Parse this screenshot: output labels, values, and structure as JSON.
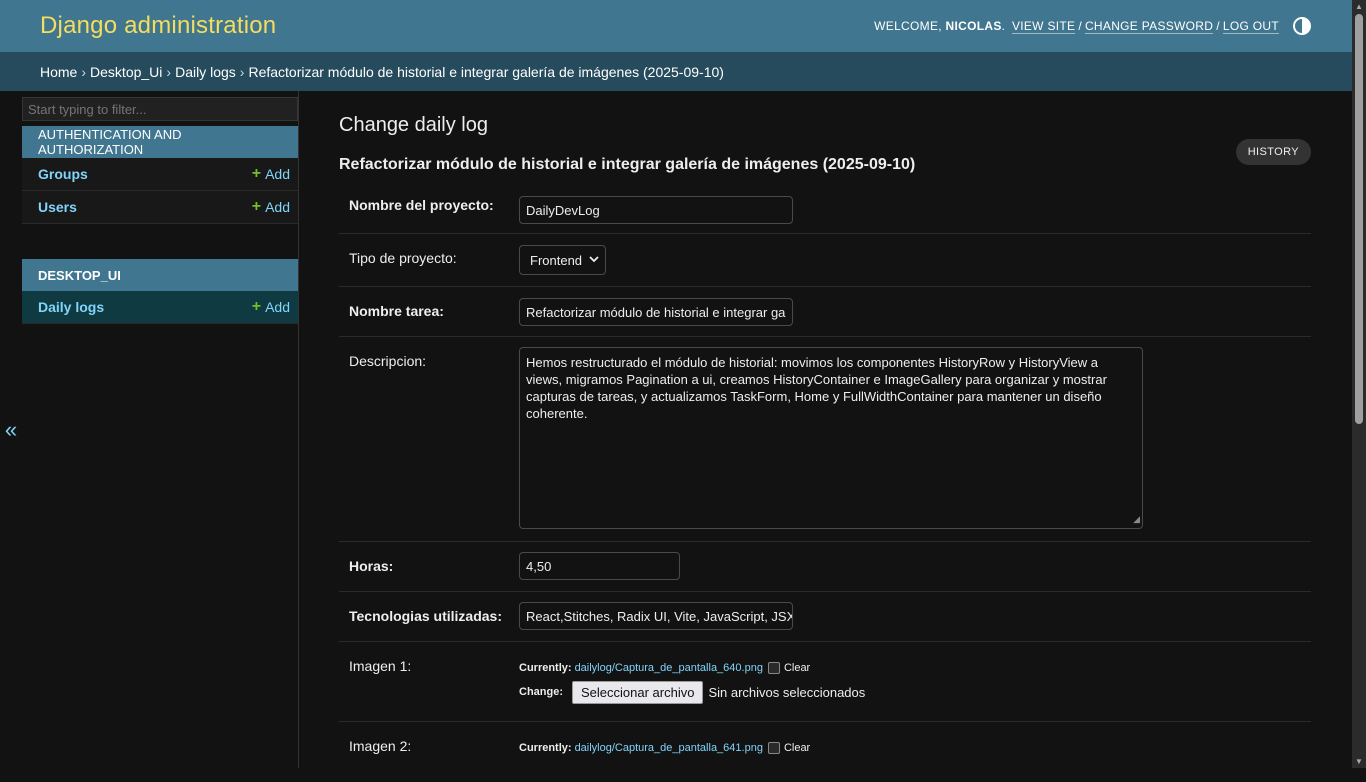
{
  "header": {
    "branding": "Django administration",
    "welcome": "WELCOME,",
    "username": "NICOLAS",
    "view_site": "VIEW SITE",
    "change_password": "CHANGE PASSWORD",
    "log_out": "LOG OUT",
    "theme_icon": "contrast-icon"
  },
  "breadcrumbs": {
    "home": "Home",
    "app": "Desktop_Ui",
    "model": "Daily logs",
    "current": "Refactorizar módulo de historial e integrar galería de imágenes (2025-09-10)"
  },
  "sidebar": {
    "filter_placeholder": "Start typing to filter...",
    "modules": [
      {
        "caption": "Authentication and Authorization",
        "items": [
          {
            "label": "Groups",
            "add": "Add"
          },
          {
            "label": "Users",
            "add": "Add"
          }
        ]
      },
      {
        "caption": "DESKTOP_UI",
        "items": [
          {
            "label": "Daily logs",
            "add": "Add"
          }
        ]
      }
    ],
    "collapse": "«"
  },
  "content": {
    "title": "Change daily log",
    "history": "HISTORY",
    "object_title": "Refactorizar módulo de historial e integrar galería de imágenes (2025-09-10)",
    "fields": {
      "nombre_proyecto": {
        "label": "Nombre del proyecto:",
        "value": "DailyDevLog"
      },
      "tipo_proyecto": {
        "label": "Tipo de proyecto:",
        "value": "Frontend"
      },
      "nombre_tarea": {
        "label": "Nombre tarea:",
        "value": "Refactorizar módulo de historial e integrar ga"
      },
      "descripcion": {
        "label": "Descripcion:",
        "value": "Hemos restructurado el módulo de historial: movimos los componentes HistoryRow y HistoryView a views, migramos Pagination a ui, creamos HistoryContainer e ImageGallery para organizar y mostrar capturas de tareas, y actualizamos TaskForm, Home y FullWidthContainer para mantener un diseño coherente."
      },
      "horas": {
        "label": "Horas:",
        "value": "4,50"
      },
      "tecnologias": {
        "label": "Tecnologias utilizadas:",
        "value": "React,Stitches, Radix UI, Vite, JavaScript, JSX, C"
      },
      "imagen1": {
        "label": "Imagen 1:",
        "currently": "Currently:",
        "file": "dailylog/Captura_de_pantalla_640.png",
        "clear": "Clear",
        "change": "Change:",
        "button": "Seleccionar archivo",
        "nofile": "Sin archivos seleccionados"
      },
      "imagen2": {
        "label": "Imagen 2:",
        "currently": "Currently:",
        "file": "dailylog/Captura_de_pantalla_641.png",
        "clear": "Clear"
      }
    }
  },
  "colors": {
    "header_bg": "#417690",
    "breadcrumbs_bg": "#264b5d",
    "branding": "#f5dd5d",
    "link": "#81d4fa",
    "add_plus": "#70bf2b",
    "body_bg": "#121212"
  }
}
